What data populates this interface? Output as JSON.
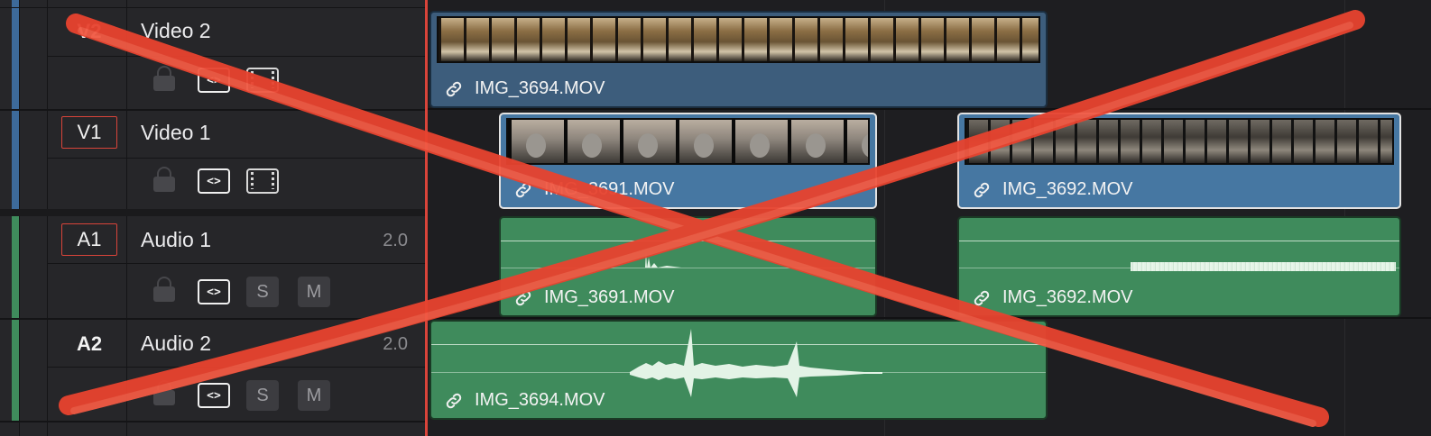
{
  "tracks": {
    "video2": {
      "badge": "V2",
      "name": "Video 2"
    },
    "video1": {
      "badge": "V1",
      "name": "Video 1"
    },
    "audio1": {
      "badge": "A1",
      "name": "Audio 1",
      "format": "2.0"
    },
    "audio2": {
      "badge": "A2",
      "name": "Audio 2",
      "format": "2.0"
    }
  },
  "buttons": {
    "code": "<>",
    "solo": "S",
    "mute": "M"
  },
  "clips": {
    "v2_clip": "IMG_3694.MOV",
    "v1_clip_a": "IMG_3691.MOV",
    "v1_clip_b": "IMG_3692.MOV",
    "a1_clip_a": "IMG_3691.MOV",
    "a1_clip_b": "IMG_3692.MOV",
    "a2_clip": "IMG_3694.MOV"
  },
  "colors": {
    "video_track": "#3d6a9a",
    "audio_track": "#3f8b5c",
    "playhead": "#d9443a",
    "cross_mark": "#e8432f"
  }
}
